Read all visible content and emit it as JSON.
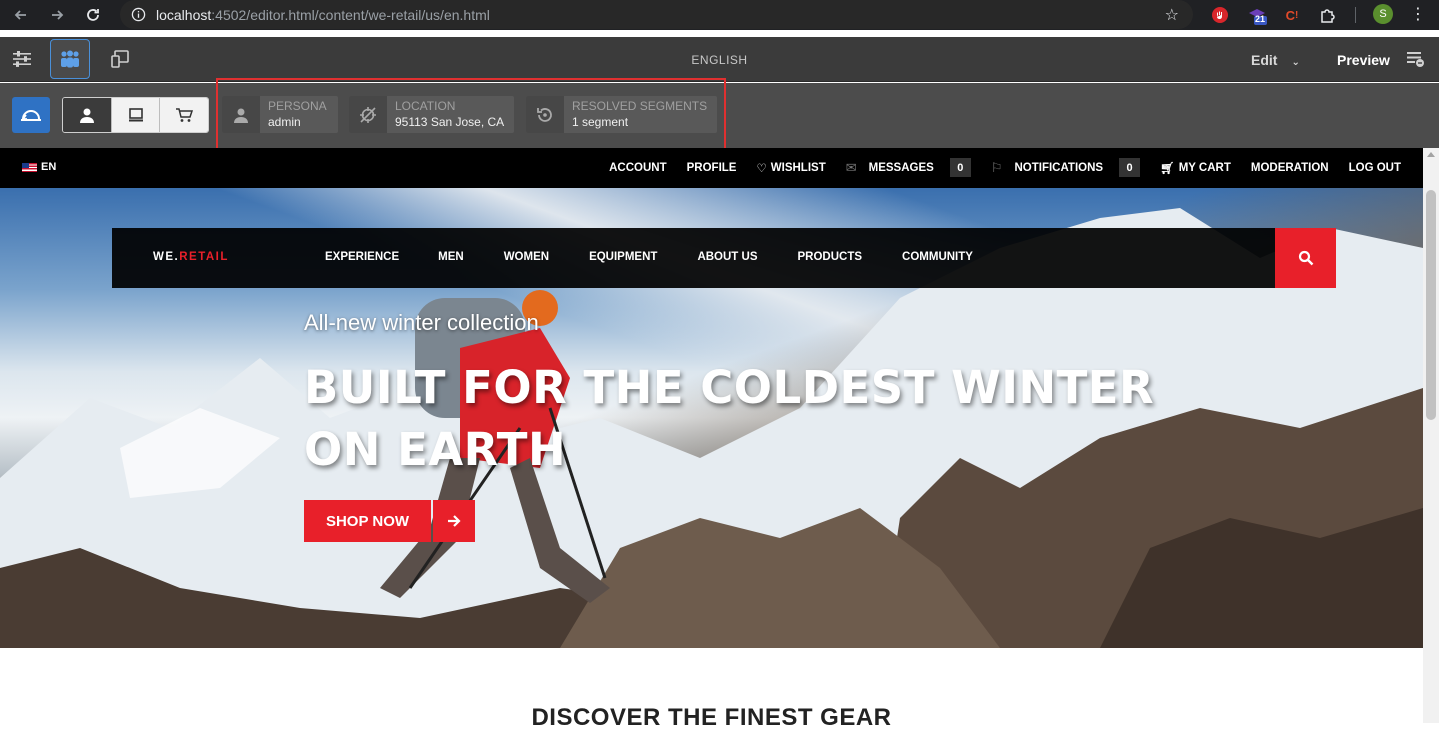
{
  "browser": {
    "url_host": "localhost",
    "url_path": ":4502/editor.html/content/we-retail/us/en.html",
    "profile_initial": "S",
    "extension_badge": "21",
    "icons": [
      "back-arrow-icon",
      "forward-arrow-icon",
      "reload-icon",
      "site-info-icon",
      "bookmark-star-icon",
      "extensions-puzzle-icon",
      "kebab-menu-icon"
    ]
  },
  "editor": {
    "title": "ENGLISH",
    "mode_label": "Edit",
    "preview_label": "Preview"
  },
  "context_hub": {
    "persona": {
      "label": "PERSONA",
      "value": "admin"
    },
    "location": {
      "label": "LOCATION",
      "value": "95113 San Jose, CA"
    },
    "segments": {
      "label": "RESOLVED SEGMENTS",
      "value": "1 segment"
    },
    "highlight_color": "#e03030"
  },
  "site": {
    "lang": "EN",
    "top_links": {
      "account": "ACCOUNT",
      "profile": "PROFILE",
      "wishlist": "WISHLIST",
      "messages": "MESSAGES",
      "messages_count": "0",
      "notifications": "NOTIFICATIONS",
      "notifications_count": "0",
      "cart": "MY CART",
      "moderation": "MODERATION",
      "logout": "LOG OUT"
    },
    "logo_prefix": "WE.",
    "logo_suffix": "RETAIL",
    "nav": [
      "EXPERIENCE",
      "MEN",
      "WOMEN",
      "EQUIPMENT",
      "ABOUT US",
      "PRODUCTS",
      "COMMUNITY"
    ],
    "accent_color": "#e8202a"
  },
  "hero": {
    "subtitle": "All-new winter collection",
    "title": "BUILT FOR THE COLDEST WINTER ON EARTH",
    "cta": "SHOP NOW"
  },
  "section": {
    "heading": "DISCOVER THE FINEST GEAR"
  }
}
